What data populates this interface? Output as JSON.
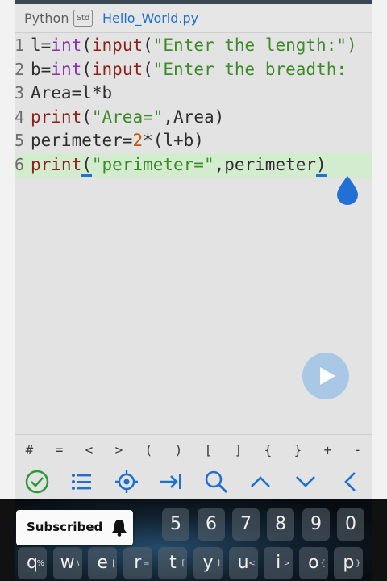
{
  "tabs": {
    "language": "Python",
    "std_badge": "Std",
    "file_name": "Hello_World.py"
  },
  "editor": {
    "lines": [
      {
        "num": "1",
        "parts": [
          [
            "c",
            "l="
          ],
          [
            "f",
            "int"
          ],
          [
            "c",
            "("
          ],
          [
            "k",
            "input"
          ],
          [
            "c",
            "("
          ],
          [
            "s",
            "\"Enter the length:\")"
          ]
        ]
      },
      {
        "num": "2",
        "parts": [
          [
            "c",
            "b="
          ],
          [
            "f",
            "int"
          ],
          [
            "c",
            "("
          ],
          [
            "k",
            "input"
          ],
          [
            "c",
            "("
          ],
          [
            "s",
            "\"Enter the breadth:"
          ]
        ]
      },
      {
        "num": "3",
        "parts": [
          [
            "c",
            "Area=l*b"
          ]
        ]
      },
      {
        "num": "4",
        "parts": [
          [
            "k",
            "print"
          ],
          [
            "c",
            "("
          ],
          [
            "s",
            "\"Area=\""
          ],
          [
            "c",
            ",Area)"
          ]
        ]
      },
      {
        "num": "5",
        "parts": [
          [
            "c",
            "perimeter="
          ],
          [
            "n",
            "2"
          ],
          [
            "c",
            "*(l+b)"
          ]
        ]
      },
      {
        "num": "6",
        "parts": [
          [
            "k",
            "print"
          ],
          [
            "c",
            "("
          ],
          [
            "s",
            "\"perimeter=\""
          ],
          [
            "c",
            ",perimeter)"
          ]
        ]
      }
    ],
    "active_line": 6
  },
  "symbols": [
    "#",
    "=",
    "<",
    ">",
    "(",
    ")",
    "[",
    "]",
    "{",
    "}",
    "+",
    "-"
  ],
  "tools": [
    "check-circle-icon",
    "list-icon",
    "target-icon",
    "tab-indent-icon",
    "search-icon",
    "chevron-up-icon",
    "chevron-down-icon",
    "chevron-left-icon"
  ],
  "keyboard": {
    "number_row": [
      "5",
      "6",
      "7",
      "8",
      "9",
      "0"
    ],
    "letter_row": [
      "q",
      "w",
      "e",
      "r",
      "t",
      "y",
      "u",
      "i",
      "o",
      "p"
    ],
    "letter_sup": [
      "%",
      "\\",
      "|",
      "=",
      "[",
      "]",
      "<",
      ">",
      "{",
      "}"
    ]
  },
  "toast": {
    "label": "Subscribed"
  },
  "colors": {
    "keyword": "#8b1f1a",
    "builtin": "#8a2fb0",
    "string": "#3d8a2a",
    "number": "#c05a0a",
    "accent": "#1e6fd0",
    "active_line": "#d3ecd0"
  }
}
